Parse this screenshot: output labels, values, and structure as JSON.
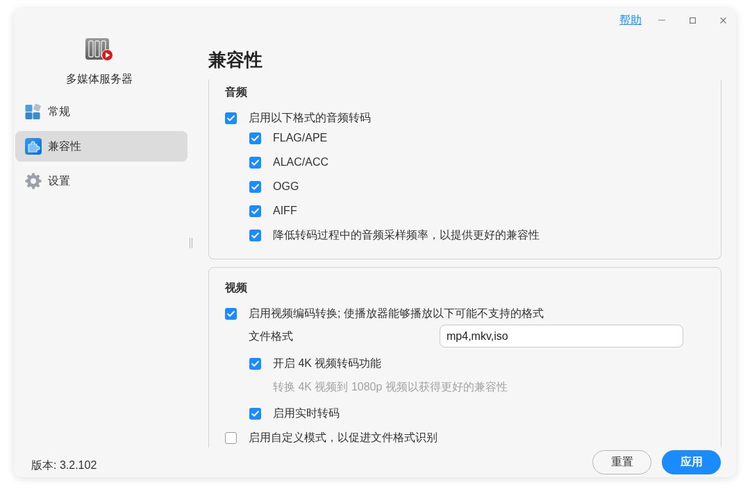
{
  "window": {
    "help_link": "帮助"
  },
  "sidebar": {
    "app_name": "多媒体服务器",
    "items": [
      {
        "label": "常规",
        "kind": "tiles",
        "selected": false
      },
      {
        "label": "兼容性",
        "kind": "puzzle",
        "selected": true
      },
      {
        "label": "设置",
        "kind": "gear",
        "selected": false
      }
    ],
    "version": "版本: 3.2.102"
  },
  "page": {
    "title": "兼容性"
  },
  "sections": [
    {
      "heading": "音频",
      "options": [
        {
          "kind": "checkbox",
          "label": "启用以下格式的音频转码",
          "checked": true,
          "children": [
            {
              "kind": "checkbox",
              "label": "FLAG/APE",
              "checked": true
            },
            {
              "kind": "checkbox",
              "label": "ALAC/ACC",
              "checked": true
            },
            {
              "kind": "checkbox",
              "label": "OGG",
              "checked": true
            },
            {
              "kind": "checkbox",
              "label": "AIFF",
              "checked": true
            },
            {
              "kind": "checkbox",
              "label": "降低转码过程中的音频采样频率，以提供更好的兼容性",
              "checked": true
            }
          ]
        }
      ]
    },
    {
      "heading": "视频",
      "options": [
        {
          "kind": "checkbox",
          "label": "启用视频编码转换; 使播放器能够播放以下可能不支持的格式",
          "checked": true,
          "field": {
            "label": "文件格式",
            "value": "mp4,mkv,iso"
          },
          "children": [
            {
              "kind": "checkbox",
              "label": "开启 4K 视频转码功能",
              "checked": true,
              "hint": "转换 4K 视频到 1080p 视频以获得更好的兼容性"
            },
            {
              "kind": "checkbox",
              "label": "启用实时转码",
              "checked": true
            }
          ]
        },
        {
          "kind": "checkbox",
          "label": "启用自定义模式，以促进文件格式识别",
          "checked": false
        }
      ]
    }
  ],
  "footer": {
    "buttons": [
      {
        "label": "重置",
        "kind": "secondary"
      },
      {
        "label": "应用",
        "kind": "primary"
      }
    ]
  }
}
